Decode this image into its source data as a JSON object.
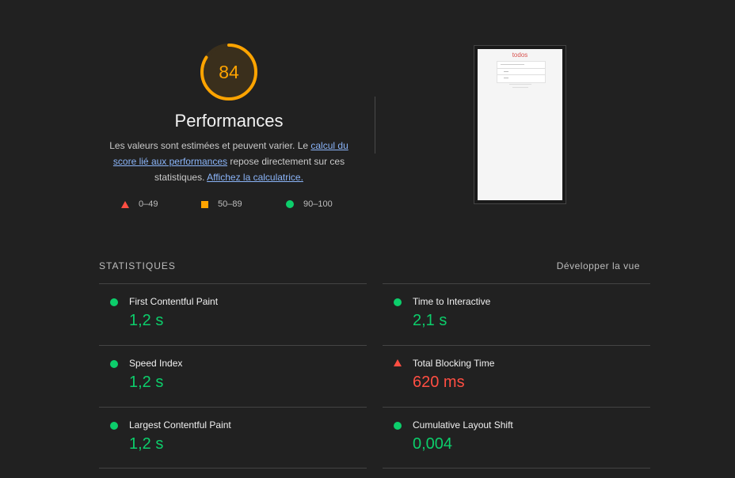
{
  "score": {
    "value": "84",
    "fraction": 0.84,
    "color": "#ffa400"
  },
  "title": "Performances",
  "description": {
    "part1": "Les valeurs sont estimées et peuvent varier. Le ",
    "link1": "calcul du score lié aux performances",
    "part2": " repose directement sur ces statistiques. ",
    "link2": "Affichez la calculatrice."
  },
  "legend": [
    {
      "icon": "red-triangle-icon",
      "label": "0–49"
    },
    {
      "icon": "orange-square-icon",
      "label": "50–89"
    },
    {
      "icon": "green-circle-icon",
      "label": "90–100"
    }
  ],
  "thumbnail": {
    "app_title": "todos"
  },
  "stats": {
    "heading": "STATISTIQUES",
    "expand_label": "Développer la vue",
    "metrics": [
      {
        "name": "First Contentful Paint",
        "value": "1,2 s",
        "status": "pass"
      },
      {
        "name": "Time to Interactive",
        "value": "2,1 s",
        "status": "pass"
      },
      {
        "name": "Speed Index",
        "value": "1,2 s",
        "status": "pass"
      },
      {
        "name": "Total Blocking Time",
        "value": "620 ms",
        "status": "fail"
      },
      {
        "name": "Largest Contentful Paint",
        "value": "1,2 s",
        "status": "pass"
      },
      {
        "name": "Cumulative Layout Shift",
        "value": "0,004",
        "status": "pass"
      }
    ]
  },
  "colors": {
    "pass": "#0cce6b",
    "average": "#ffa400",
    "fail": "#ff4e42",
    "link": "#8ab4f8"
  }
}
